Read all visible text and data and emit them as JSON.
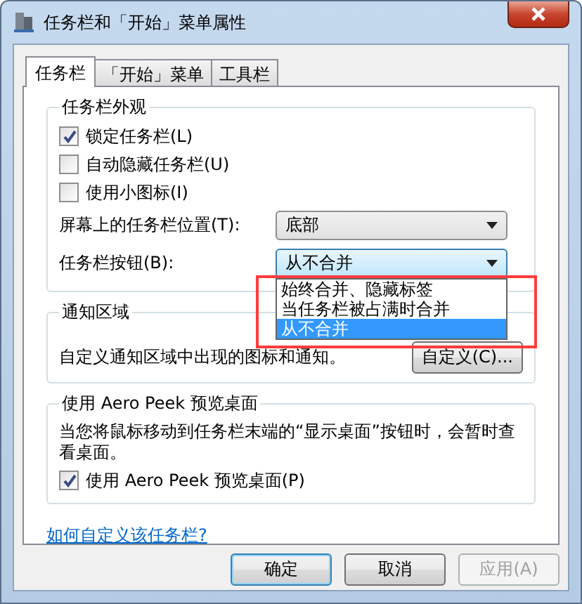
{
  "window": {
    "title": "任务栏和「开始」菜单属性"
  },
  "tabs": [
    {
      "label": "任务栏",
      "selected": true
    },
    {
      "label": "「开始」菜单",
      "selected": false
    },
    {
      "label": "工具栏",
      "selected": false
    }
  ],
  "appearance": {
    "title": "任务栏外观",
    "options": [
      {
        "label": "锁定任务栏(L)",
        "checked": true
      },
      {
        "label": "自动隐藏任务栏(U)",
        "checked": false
      },
      {
        "label": "使用小图标(I)",
        "checked": false
      }
    ],
    "fields": [
      {
        "label": "屏幕上的任务栏位置(T):",
        "value": "底部",
        "open": false
      },
      {
        "label": "任务栏按钮(B):",
        "value": "从不合并",
        "open": true
      }
    ]
  },
  "dropdown_list": {
    "items": [
      {
        "label": "始终合并、隐藏标签",
        "selected": false
      },
      {
        "label": "当任务栏被占满时合并",
        "selected": false
      },
      {
        "label": "从不合并",
        "selected": true
      }
    ]
  },
  "notification_area": {
    "title": "通知区域",
    "text": "自定义通知区域中出现的图标和通知。",
    "button": "自定义(C)..."
  },
  "aero_peek": {
    "title": "使用 Aero Peek 预览桌面",
    "description": "当您将鼠标移动到任务栏末端的“显示桌面”按钮时，会暂时查看桌面。",
    "option": {
      "label": "使用 Aero Peek 预览桌面(P)",
      "checked": true
    }
  },
  "link": "如何自定义该任务栏?",
  "buttons": [
    {
      "label": "确定",
      "default": true,
      "disabled": false
    },
    {
      "label": "取消",
      "default": false,
      "disabled": false
    },
    {
      "label": "应用(A)",
      "default": false,
      "disabled": true
    }
  ]
}
